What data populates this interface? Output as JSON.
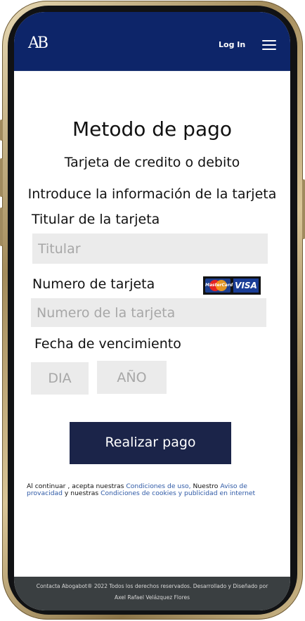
{
  "header": {
    "logo": "AB",
    "login_label": "Log In",
    "menu_icon": "hamburger-menu-icon"
  },
  "main": {
    "title": "Metodo de pago",
    "subtitle": "Tarjeta de credito o debito",
    "intro": "Introduce la información de la tarjeta",
    "cardholder_label": "Titular de la tarjeta",
    "cardholder_placeholder": "Titular",
    "card_number_label": "Numero de tarjeta",
    "card_number_placeholder": "Numero de la tarjeta",
    "card_logos": {
      "mastercard": "MasterCard",
      "visa": "VISA"
    },
    "expiry_label": "Fecha de vencimiento",
    "day_placeholder": "DIA",
    "year_placeholder": "AÑO",
    "pay_button": "Realizar pago"
  },
  "legal": {
    "text_1": "Al continuar , acepta  nuestras ",
    "link_terms": "Condiciones de uso,",
    "text_2": " Nuestro ",
    "link_privacy": "Aviso de provacidad",
    "text_3": " y  nuestras ",
    "link_cookies": "Condiciones de cookies y publicidad en internet"
  },
  "footer": {
    "line1": "Contacta Abogabot® 2022 Todos los derechos reservados. Desarrollado y Diseñado por",
    "line2": "Axel Rafael Velázquez Flores"
  },
  "colors": {
    "header_bg": "#0d2569",
    "button_bg": "#1b2449",
    "link": "#2f5aa6",
    "footer_bg": "#3a3f41",
    "field_bg": "#ebebeb"
  }
}
